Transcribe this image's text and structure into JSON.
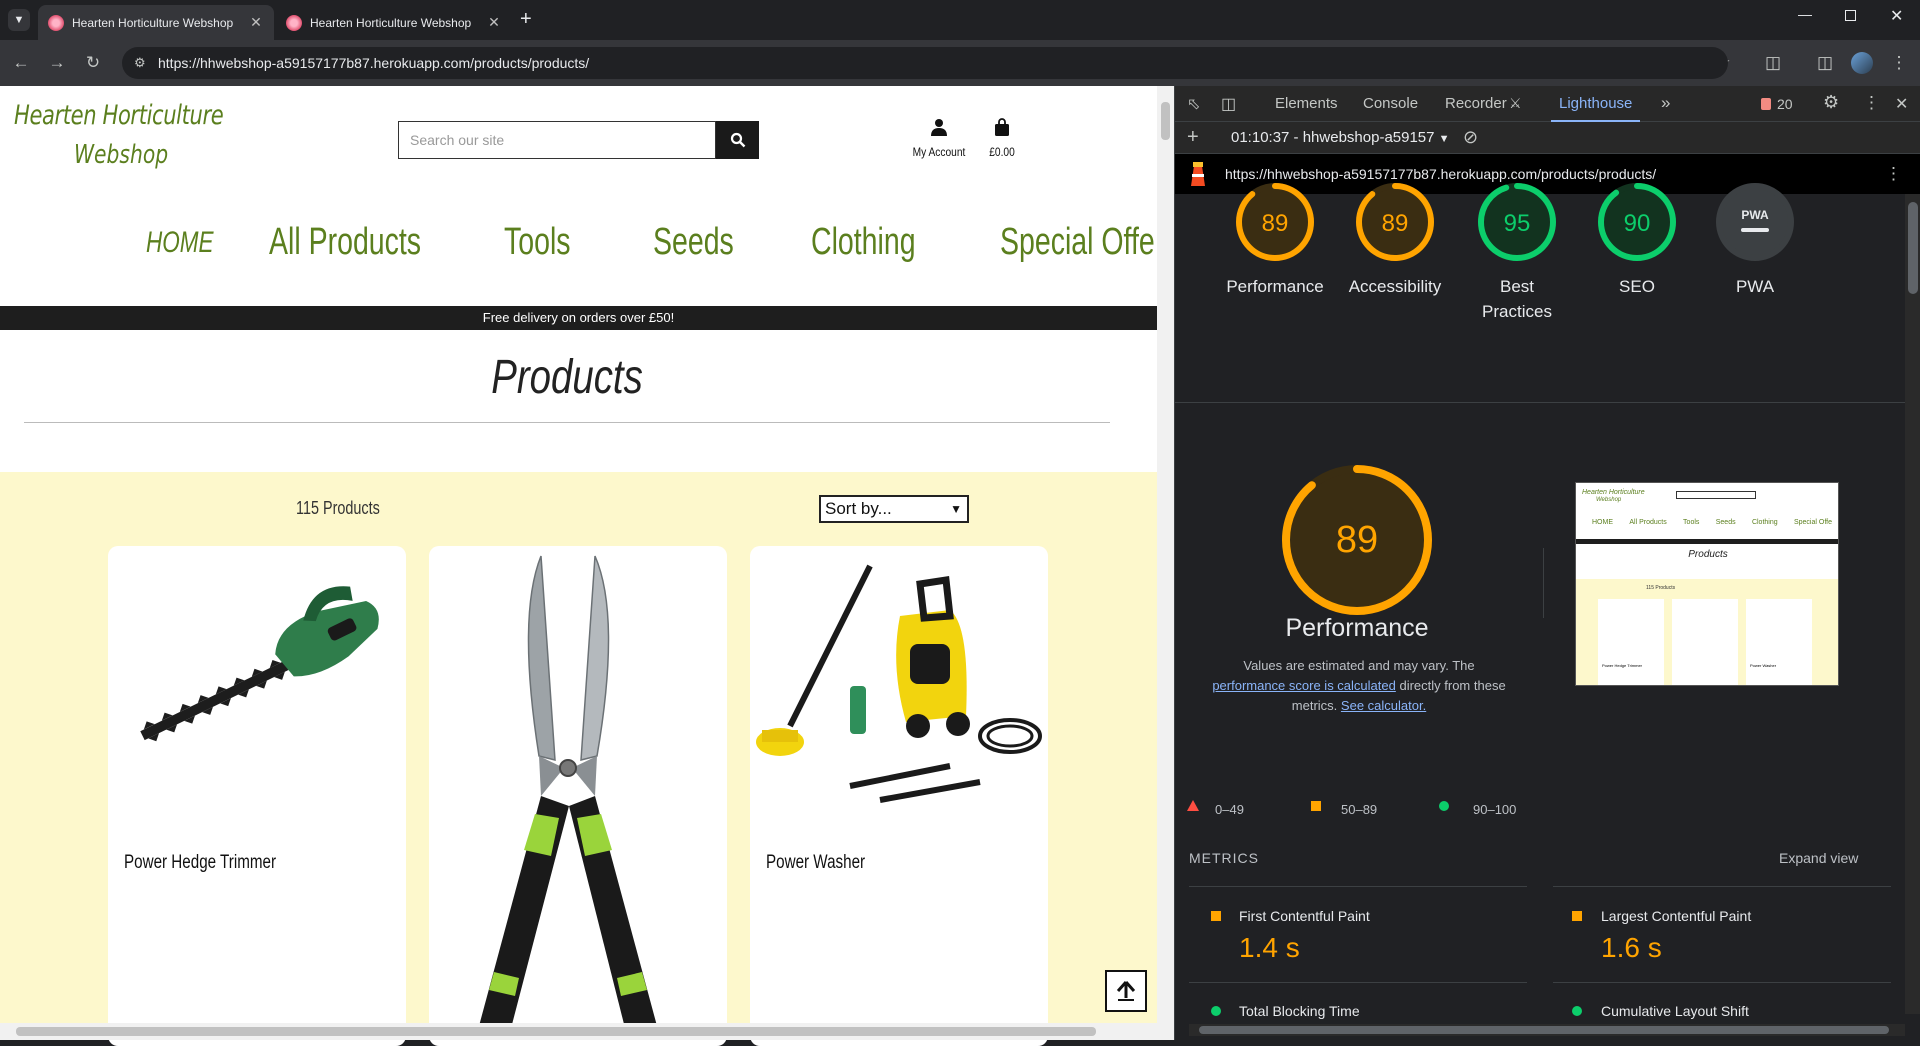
{
  "browser": {
    "tabs": [
      {
        "title": "Hearten Horticulture Webshop"
      },
      {
        "title": "Hearten Horticulture Webshop"
      }
    ],
    "url": "https://hhwebshop-a59157177b87.herokuapp.com/products/products/"
  },
  "site": {
    "logo_line1": "Hearten Horticulture",
    "logo_line2": "Webshop",
    "search_placeholder": "Search our site",
    "account_label": "My Account",
    "basket_total": "£0.00",
    "menu": [
      "HOME",
      "All Products",
      "Tools",
      "Seeds",
      "Clothing",
      "Special Offe"
    ],
    "promo": "Free delivery on orders over £50!",
    "page_title": "Products",
    "product_count": "115 Products",
    "sort_label": "Sort by...",
    "products": [
      {
        "name": "Power Hedge Trimmer"
      },
      {
        "name": ""
      },
      {
        "name": "Power Washer"
      }
    ]
  },
  "devtools": {
    "tabs": [
      "Elements",
      "Console",
      "Recorder",
      "Lighthouse"
    ],
    "issues_count": "20",
    "report_label": "01:10:37 - hhwebshop-a59157",
    "report_url": "https://hhwebshop-a59157177b87.herokuapp.com/products/products/",
    "scores": [
      {
        "label": "Performance",
        "score": "89",
        "value": 89,
        "color": "#ffa400"
      },
      {
        "label": "Accessibility",
        "score": "89",
        "value": 89,
        "color": "#ffa400"
      },
      {
        "label": "Best Practices",
        "score": "95",
        "value": 95,
        "color": "#0cce6b"
      },
      {
        "label": "SEO",
        "score": "90",
        "value": 90,
        "color": "#0cce6b"
      },
      {
        "label": "PWA",
        "score": "PWA",
        "value": 0,
        "color": "#9aa0a6"
      }
    ],
    "perf": {
      "score": "89",
      "value": 89,
      "title": "Performance",
      "desc_1": "Values are estimated and may vary. The",
      "link_1": "performance score is calculated",
      "desc_2": "directly from these",
      "desc_3": "metrics.",
      "link_2": "See calculator."
    },
    "legend": [
      "0–49",
      "50–89",
      "90–100"
    ],
    "metrics_heading": "METRICS",
    "expand_view": "Expand view",
    "metrics": [
      {
        "name": "First Contentful Paint",
        "value": "1.4 s"
      },
      {
        "name": "Largest Contentful Paint",
        "value": "1.6 s"
      },
      {
        "name": "Total Blocking Time",
        "value": ""
      },
      {
        "name": "Cumulative Layout Shift",
        "value": ""
      }
    ],
    "thumb": {
      "logo1": "Hearten Horticulture",
      "logo2": "Webshop",
      "menu": [
        "HOME",
        "All Products",
        "Tools",
        "Seeds",
        "Clothing",
        "Special Offe"
      ],
      "title": "Products",
      "count": "115 Products",
      "names": [
        "Power Hedge Trimmer",
        "Power Washer"
      ]
    }
  }
}
